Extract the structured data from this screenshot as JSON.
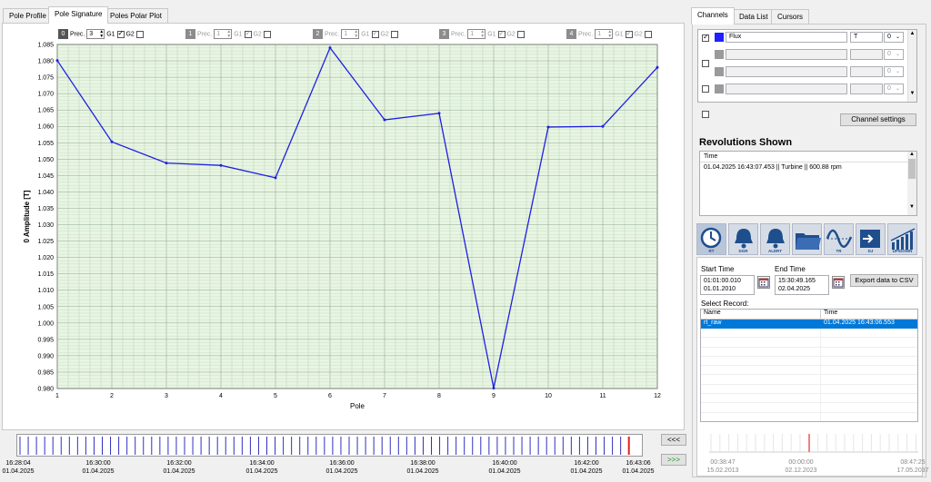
{
  "left_tabs": [
    "Pole Profile",
    "Pole Signature",
    "Poles Polar Plot"
  ],
  "left_active": "Pole Signature",
  "signature_controls": [
    {
      "num": "0",
      "prec_label": "Prec.",
      "prec": "3",
      "g1": "G1",
      "g2": "G2",
      "g1_on": true,
      "g2_on": false,
      "enabled": true
    },
    {
      "num": "1",
      "prec_label": "Prec.",
      "prec": "1",
      "g1": "G1",
      "g2": "G2",
      "g1_on": true,
      "g2_on": false,
      "enabled": false
    },
    {
      "num": "2",
      "prec_label": "Prec.",
      "prec": "1",
      "g1": "G1",
      "g2": "G2",
      "g1_on": true,
      "g2_on": false,
      "enabled": false
    },
    {
      "num": "3",
      "prec_label": "Prec.",
      "prec": "1",
      "g1": "G1",
      "g2": "G2",
      "g1_on": true,
      "g2_on": false,
      "enabled": false
    },
    {
      "num": "4",
      "prec_label": "Prec.",
      "prec": "1",
      "g1": "G1",
      "g2": "G2",
      "g1_on": true,
      "g2_on": false,
      "enabled": false
    }
  ],
  "chart_data": {
    "type": "line",
    "xlabel": "Pole",
    "ylabel": "0 Amplitude  [T]",
    "x": [
      1,
      2,
      3,
      4,
      5,
      6,
      7,
      8,
      9,
      10,
      11,
      12
    ],
    "ylim": [
      0.98,
      1.085
    ],
    "yticks": [
      "1.085",
      "1.080",
      "1.075",
      "1.070",
      "1.065",
      "1.060",
      "1.055",
      "1.050",
      "1.045",
      "1.040",
      "1.035",
      "1.030",
      "1.025",
      "1.020",
      "1.015",
      "1.010",
      "1.005",
      "1.000",
      "0.995",
      "0.990",
      "0.985",
      "0.980"
    ],
    "series": [
      {
        "values": [
          1.0801,
          1.0553,
          1.0488,
          1.0481,
          1.0443,
          1.084,
          1.062,
          1.064,
          0.9801,
          1.0598,
          1.06,
          1.078
        ],
        "color": "#2020e0"
      }
    ],
    "grid": true,
    "background": "#e8f5e2"
  },
  "timeline": {
    "labels": [
      {
        "time": "16:28:04",
        "date": "01.04.2025"
      },
      {
        "time": "16:30:00",
        "date": "01.04.2025"
      },
      {
        "time": "16:32:00",
        "date": "01.04.2025"
      },
      {
        "time": "16:34:00",
        "date": "01.04.2025"
      },
      {
        "time": "16:36:00",
        "date": "01.04.2025"
      },
      {
        "time": "16:38:00",
        "date": "01.04.2025"
      },
      {
        "time": "16:40:00",
        "date": "01.04.2025"
      },
      {
        "time": "16:42:00",
        "date": "01.04.2025"
      },
      {
        "time": "16:43:06",
        "date": "01.04.2025"
      }
    ],
    "prev_label": "<<<",
    "next_label": ">>>"
  },
  "right_tabs": [
    "Channels",
    "Data List",
    "Cursors"
  ],
  "right_active": "Channels",
  "channels": [
    {
      "enabled": true,
      "color": "#2020ff",
      "name": "Flux",
      "unit": "T",
      "index": "0"
    },
    {
      "enabled": false,
      "color": "#9a9a9a",
      "name": "",
      "unit": "",
      "index": "0"
    },
    {
      "enabled": false,
      "color": "#9a9a9a",
      "name": "",
      "unit": "",
      "index": "0"
    },
    {
      "enabled": false,
      "color": "#9a9a9a",
      "name": "",
      "unit": "",
      "index": "0"
    }
  ],
  "channel_settings_label": "Channel settings",
  "revolutions": {
    "title": "Revolutions Shown",
    "header": "Time",
    "items": [
      "01.04.2025 16:43:07.453 || Turbine || 600.88 rpm"
    ]
  },
  "toolbar_icons": [
    {
      "name": "rt-clock-icon",
      "label": "RT"
    },
    {
      "name": "dgr-alarm-icon",
      "label": "DGR"
    },
    {
      "name": "alert-alarm-icon",
      "label": "ALERT"
    },
    {
      "name": "folder-icon",
      "label": ""
    },
    {
      "name": "trend-tr-icon",
      "label": "TR"
    },
    {
      "name": "export-dj-icon",
      "label": "DJ"
    },
    {
      "name": "updown-chart-icon",
      "label": "UP/DOWN"
    }
  ],
  "record": {
    "start_label": "Start Time",
    "start_time": "01:01:00.010",
    "start_date": "01.01.2010",
    "end_label": "End Time",
    "end_time": "15:30:49.165",
    "end_date": "02.04.2025",
    "export_label": "Export data to CSV",
    "select_label": "Select Record:",
    "columns": [
      "Name",
      "Time"
    ],
    "rows": [
      {
        "name": "rt_raw",
        "time": "01.04.2025 16:43:06.553"
      }
    ]
  },
  "mini_timeline": [
    {
      "time": "00:38:47",
      "date": "15.02.2013"
    },
    {
      "time": "00:00:00",
      "date": "02.12.2023"
    },
    {
      "time": "08:47:25",
      "date": "17.05.2037"
    }
  ]
}
